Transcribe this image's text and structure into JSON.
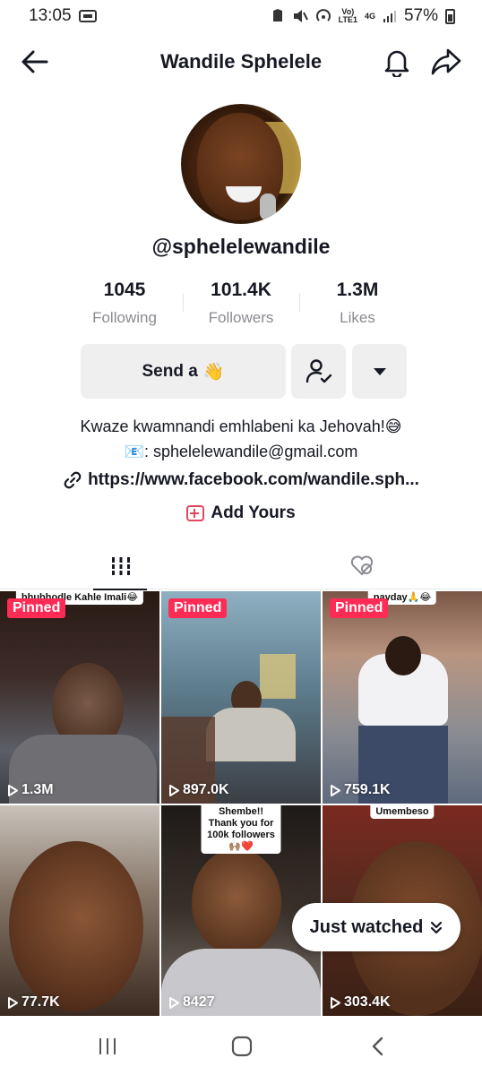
{
  "status_bar": {
    "time": "13:05",
    "network_top": "Vo)",
    "network_bottom": "LTE1",
    "net_type": "4G",
    "battery": "57%"
  },
  "header": {
    "title": "Wandile Sphelele"
  },
  "profile": {
    "username": "@sphelelewandile",
    "stats": [
      {
        "value": "1045",
        "label": "Following"
      },
      {
        "value": "101.4K",
        "label": "Followers"
      },
      {
        "value": "1.3M",
        "label": "Likes"
      }
    ],
    "send_button": "Send a",
    "send_emoji": "👋",
    "bio_line1": "Kwaze kwamnandi emhlabeni ka Jehovah!😅",
    "bio_line2_icon": "📧",
    "bio_line2": ": sphelelewandile@gmail.com",
    "link": "https://www.facebook.com/wandile.sph...",
    "add_yours": "Add Yours"
  },
  "videos": [
    {
      "pinned": "Pinned",
      "views": "1.3M",
      "caption": "bhubhodle Kahle Imali😂"
    },
    {
      "pinned": "Pinned",
      "views": "897.0K",
      "caption": ""
    },
    {
      "pinned": "Pinned",
      "views": "759.1K",
      "caption": "payday🙏😂"
    },
    {
      "pinned": "",
      "views": "77.7K",
      "caption": ""
    },
    {
      "pinned": "",
      "views": "8427",
      "caption": "Shembe!! Thank you for 100k followers🙌🏽❤️"
    },
    {
      "pinned": "",
      "views": "303.4K",
      "caption": "Umembeso"
    }
  ],
  "just_watched": "Just watched",
  "colors": {
    "accent": "#fe2c55",
    "button_bg": "#efeff0",
    "muted_text": "#8a8b91"
  }
}
